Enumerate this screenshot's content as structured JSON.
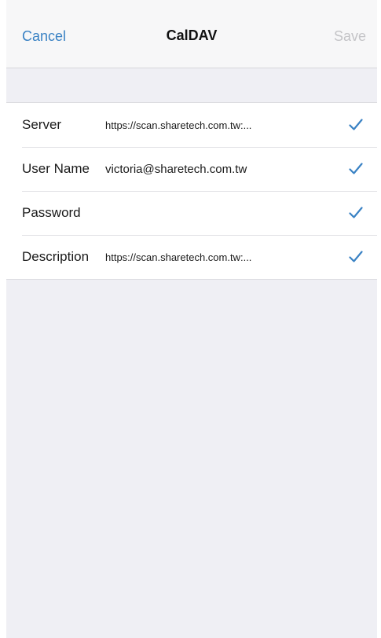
{
  "nav": {
    "cancel_label": "Cancel",
    "title": "CalDAV",
    "save_label": "Save"
  },
  "form": {
    "rows": [
      {
        "label": "Server",
        "value": "https://scan.sharetech.com.tw:...",
        "check_icon": "checkmark-icon"
      },
      {
        "label": "User Name",
        "value": "victoria@sharetech.com.tw",
        "check_icon": "checkmark-icon"
      },
      {
        "label": "Password",
        "value": "",
        "check_icon": "checkmark-icon"
      },
      {
        "label": "Description",
        "value": "https://scan.sharetech.com.tw:...",
        "check_icon": "checkmark-icon"
      }
    ]
  },
  "colors": {
    "accent": "#3a82c4",
    "disabled": "#c4c4c7",
    "background": "#efeff4"
  }
}
